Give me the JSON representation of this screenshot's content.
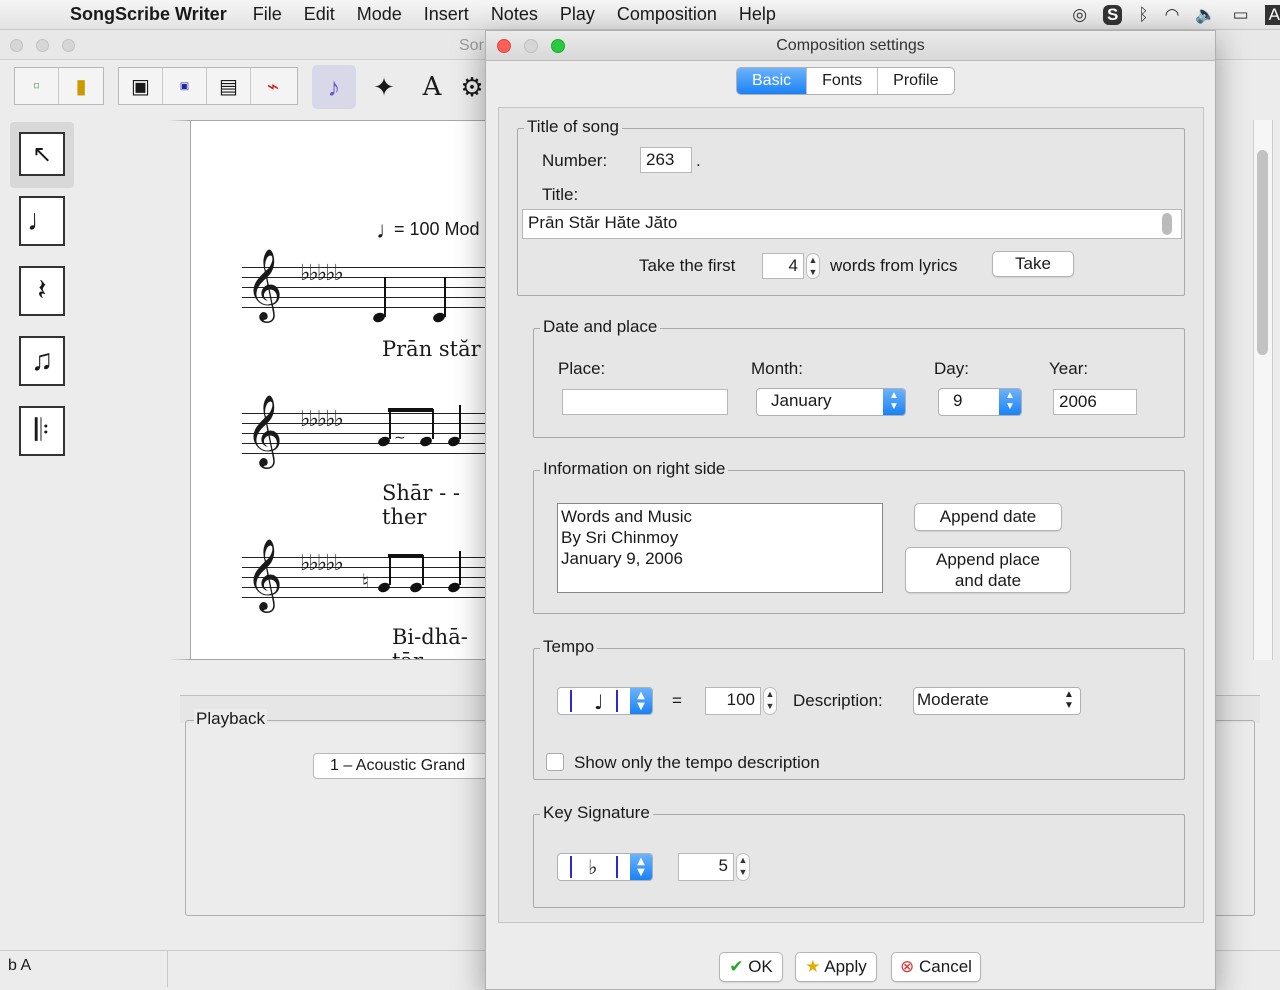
{
  "menubar": {
    "app_name": "SongScribe Writer",
    "menus": [
      "File",
      "Edit",
      "Mode",
      "Insert",
      "Notes",
      "Play",
      "Composition",
      "Help"
    ],
    "status_icons": [
      "creative-cloud-icon",
      "skype-icon",
      "bluetooth-icon",
      "wifi-icon",
      "volume-icon",
      "battery-icon",
      "keyboard-input-icon"
    ],
    "input_indicator": "A"
  },
  "main_window": {
    "title_fragment": "Sor",
    "score": {
      "tempo_text": "= 100 Mod",
      "lyrics": [
        "Prān  stăr",
        "Shār - - ther",
        "Bi-dhā-tār"
      ]
    },
    "playback": {
      "legend": "Playback",
      "instrument": "1 – Acoustic Grand"
    },
    "status_text": "b A"
  },
  "dialog": {
    "title": "Composition settings",
    "tabs": [
      "Basic",
      "Fonts",
      "Profile"
    ],
    "active_tab": "Basic",
    "title_group": {
      "legend": "Title of song",
      "number_label": "Number:",
      "number_value": "263",
      "number_suffix": ".",
      "title_label": "Title:",
      "title_value": "Prān Stăr Hăte Jăto",
      "take_prefix": "Take the first",
      "take_count": "4",
      "take_suffix": "words from lyrics",
      "take_button": "Take"
    },
    "date_group": {
      "legend": "Date and place",
      "place_label": "Place:",
      "place_value": "",
      "month_label": "Month:",
      "month_value": "January",
      "day_label": "Day:",
      "day_value": "9",
      "year_label": "Year:",
      "year_value": "2006"
    },
    "info_group": {
      "legend": "Information on right side",
      "text": "Words and Music\nBy Sri Chinmoy\nJanuary 9, 2006",
      "append_date": "Append date",
      "append_place_line1": "Append place",
      "append_place_line2": "and date"
    },
    "tempo_group": {
      "legend": "Tempo",
      "equals": "=",
      "bpm": "100",
      "description_label": "Description:",
      "description_value": "Moderate",
      "show_only_label": "Show only the tempo description",
      "show_only_checked": false
    },
    "key_group": {
      "legend": "Key Signature",
      "accidental": "♭",
      "count": "5"
    },
    "buttons": {
      "ok": "OK",
      "apply": "Apply",
      "cancel": "Cancel"
    }
  }
}
